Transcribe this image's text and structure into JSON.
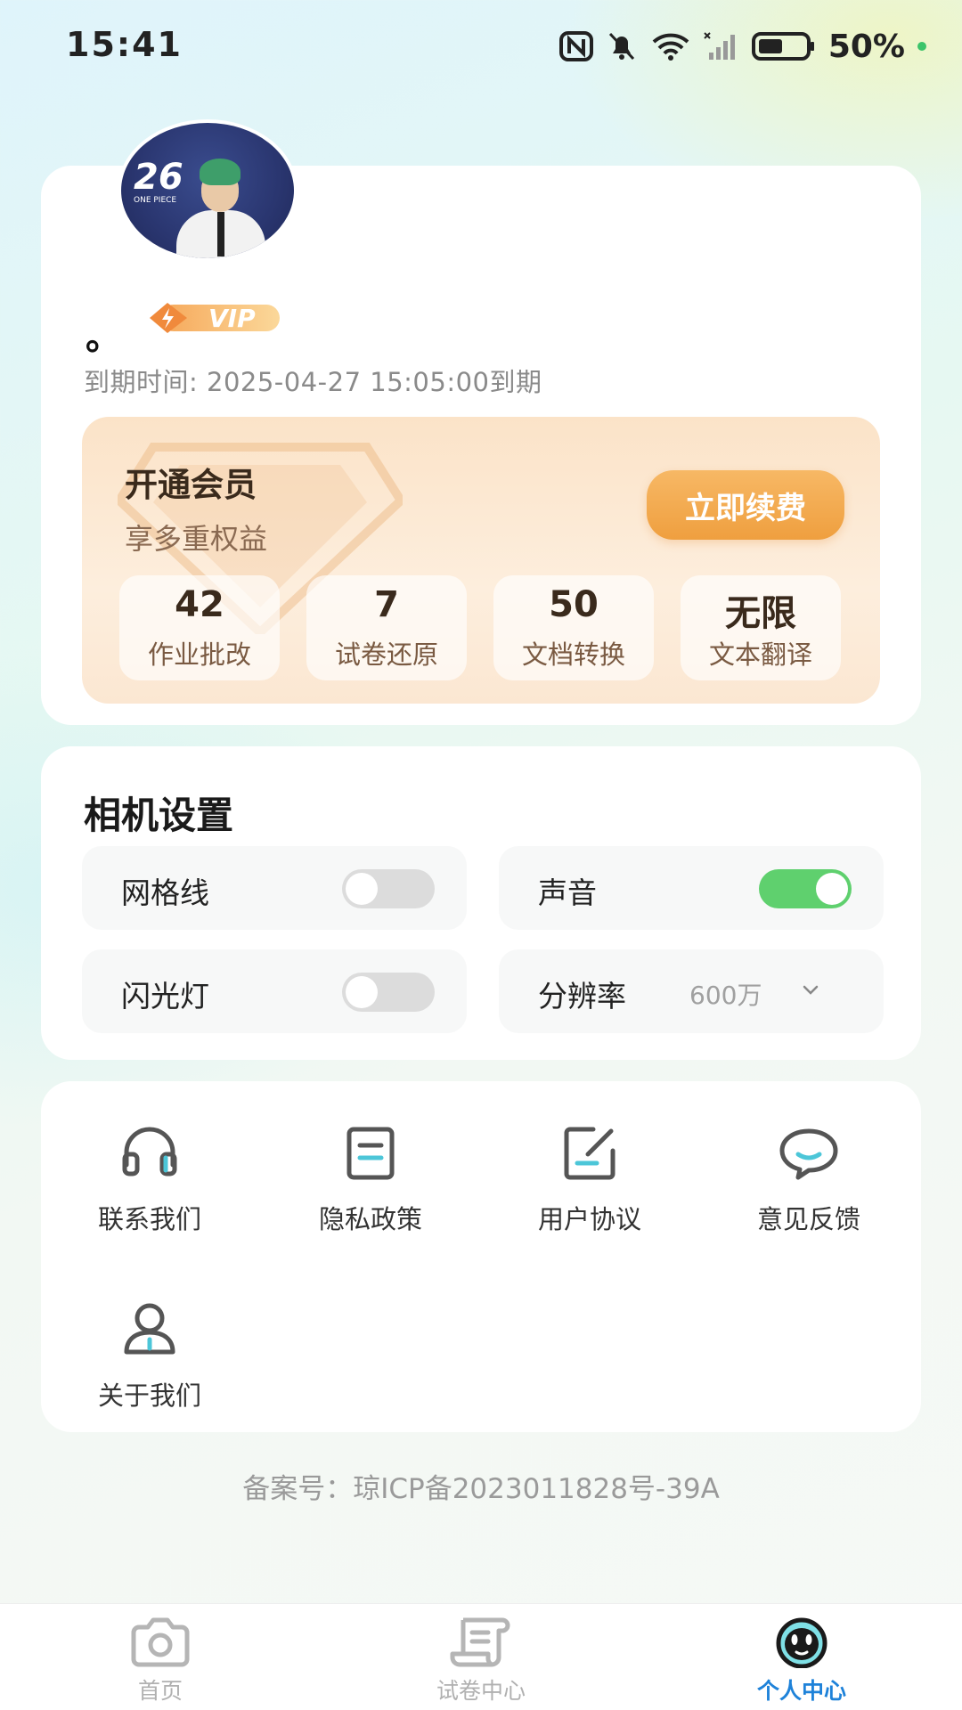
{
  "status_bar": {
    "time": "15:41",
    "battery": "50%"
  },
  "profile": {
    "avatar_text": "26",
    "avatar_subtext": "ONE PIECE",
    "user_name": "。",
    "vip_label": "VIP",
    "expire_text": "到期时间: 2025-04-27 15:05:00到期"
  },
  "membership": {
    "title": "开通会员",
    "subtitle": "享多重权益",
    "renew_button": "立即续费",
    "quotas": [
      {
        "value": "42",
        "label": "作业批改"
      },
      {
        "value": "7",
        "label": "试卷还原"
      },
      {
        "value": "50",
        "label": "文档转换"
      },
      {
        "value": "无限",
        "label": "文本翻译"
      }
    ]
  },
  "camera_settings": {
    "title": "相机设置",
    "grid_lines": {
      "label": "网格线",
      "enabled": false
    },
    "sound": {
      "label": "声音",
      "enabled": true
    },
    "flash": {
      "label": "闪光灯",
      "enabled": false
    },
    "resolution": {
      "label": "分辨率",
      "value": "600万"
    }
  },
  "links": [
    {
      "label": "联系我们",
      "icon": "headset-icon"
    },
    {
      "label": "隐私政策",
      "icon": "document-icon"
    },
    {
      "label": "用户协议",
      "icon": "edit-document-icon"
    },
    {
      "label": "意见反馈",
      "icon": "chat-bubble-icon"
    },
    {
      "label": "关于我们",
      "icon": "user-icon"
    }
  ],
  "icp": "备案号：琼ICP备2023011828号-39A",
  "bottom_nav": {
    "items": [
      {
        "label": "首页",
        "icon": "camera-icon",
        "active": false
      },
      {
        "label": "试卷中心",
        "icon": "paper-scroll-icon",
        "active": false
      },
      {
        "label": "个人中心",
        "icon": "smiley-face-icon",
        "active": true
      }
    ]
  },
  "colors": {
    "accent_blue": "#1e82d9",
    "renew_orange": "#ef9f3f",
    "toggle_on": "#5fd06e",
    "toggle_off": "#dcdcdc"
  }
}
